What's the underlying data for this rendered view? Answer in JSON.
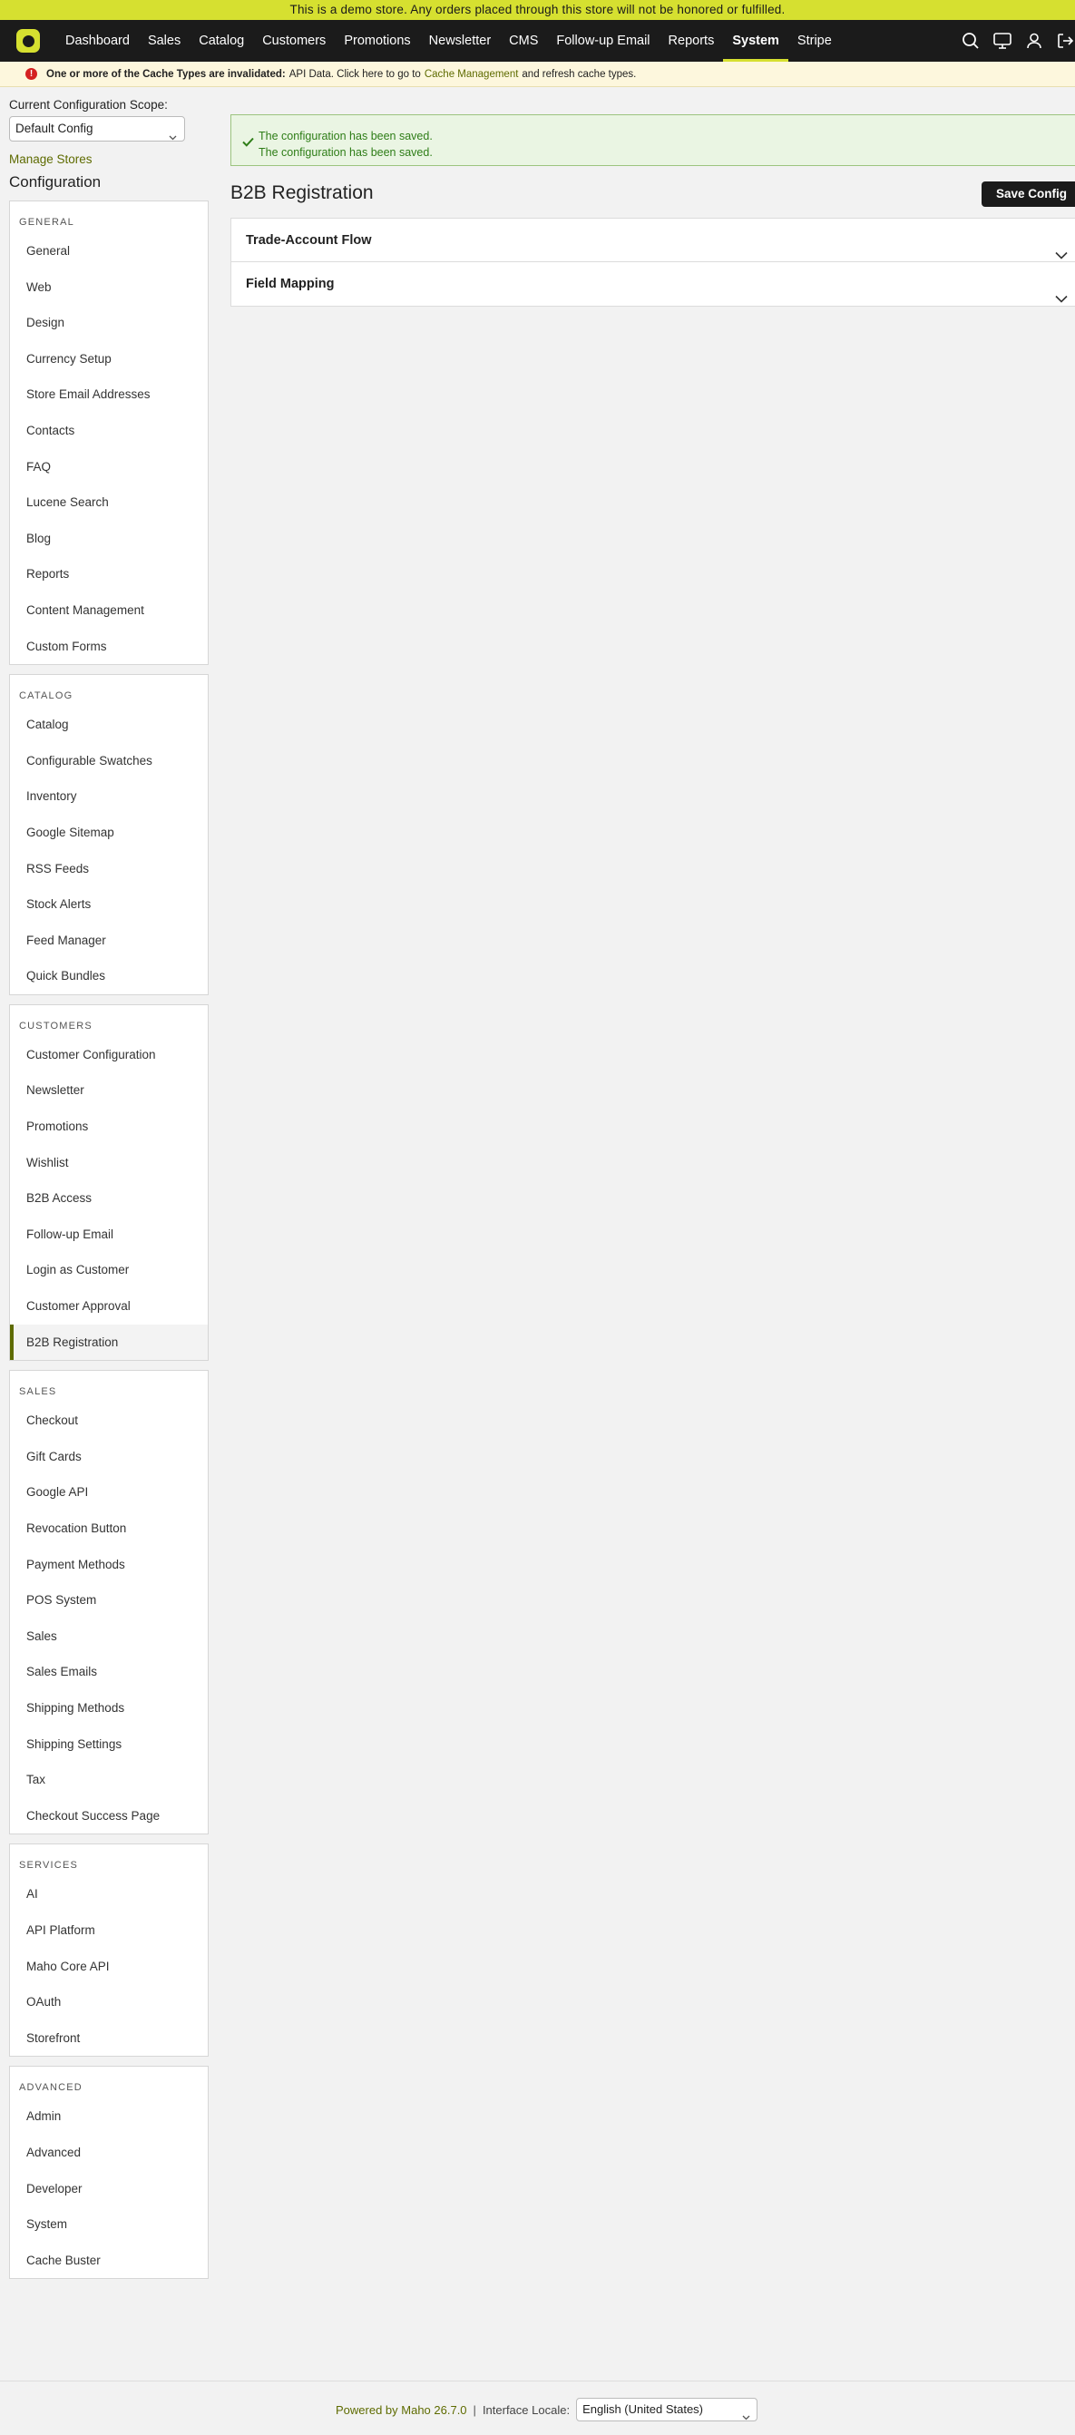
{
  "demo_banner": "This is a demo store. Any orders placed through this store will not be honored or fulfilled.",
  "nav": {
    "items": [
      "Dashboard",
      "Sales",
      "Catalog",
      "Customers",
      "Promotions",
      "Newsletter",
      "CMS",
      "Follow-up Email",
      "Reports",
      "System",
      "Stripe"
    ],
    "active": "System",
    "icons": [
      "search-icon",
      "monitor-icon",
      "user-icon",
      "logout-icon"
    ]
  },
  "notice": {
    "bold": "One or more of the Cache Types are invalidated:",
    "text1": "API Data. Click here to go to",
    "link": "Cache Management",
    "text2": "and refresh cache types."
  },
  "sidebar": {
    "scope_label": "Current Configuration Scope:",
    "scope_value": "Default Config",
    "manage_stores": "Manage Stores",
    "title": "Configuration",
    "groups": [
      {
        "title": "General",
        "items": [
          "General",
          "Web",
          "Design",
          "Currency Setup",
          "Store Email Addresses",
          "Contacts",
          "FAQ",
          "Lucene Search",
          "Blog",
          "Reports",
          "Content Management",
          "Custom Forms"
        ]
      },
      {
        "title": "Catalog",
        "items": [
          "Catalog",
          "Configurable Swatches",
          "Inventory",
          "Google Sitemap",
          "RSS Feeds",
          "Stock Alerts",
          "Feed Manager",
          "Quick Bundles"
        ]
      },
      {
        "title": "Customers",
        "items": [
          "Customer Configuration",
          "Newsletter",
          "Promotions",
          "Wishlist",
          "B2B Access",
          "Follow-up Email",
          "Login as Customer",
          "Customer Approval",
          "B2B Registration"
        ]
      },
      {
        "title": "Sales",
        "items": [
          "Checkout",
          "Gift Cards",
          "Google API",
          "Revocation Button",
          "Payment Methods",
          "POS System",
          "Sales",
          "Sales Emails",
          "Shipping Methods",
          "Shipping Settings",
          "Tax",
          "Checkout Success Page"
        ]
      },
      {
        "title": "Services",
        "items": [
          "AI",
          "API Platform",
          "Maho Core API",
          "OAuth",
          "Storefront"
        ]
      },
      {
        "title": "Advanced",
        "items": [
          "Admin",
          "Advanced",
          "Developer",
          "System",
          "Cache Buster"
        ]
      }
    ],
    "active_item": "B2B Registration"
  },
  "main": {
    "messages": [
      "The configuration has been saved.",
      "The configuration has been saved."
    ],
    "title": "B2B Registration",
    "save_label": "Save Config",
    "sections": [
      "Trade-Account Flow",
      "Field Mapping"
    ]
  },
  "footer": {
    "powered": "Powered by Maho 26.7.0",
    "separator": "|",
    "locale_label": "Interface Locale:",
    "locale_value": "English (United States)"
  },
  "colors": {
    "accent": "#d6e030",
    "link": "#5e6b00",
    "nav_bg": "#1b1b1b",
    "success": "#2e7d17"
  }
}
